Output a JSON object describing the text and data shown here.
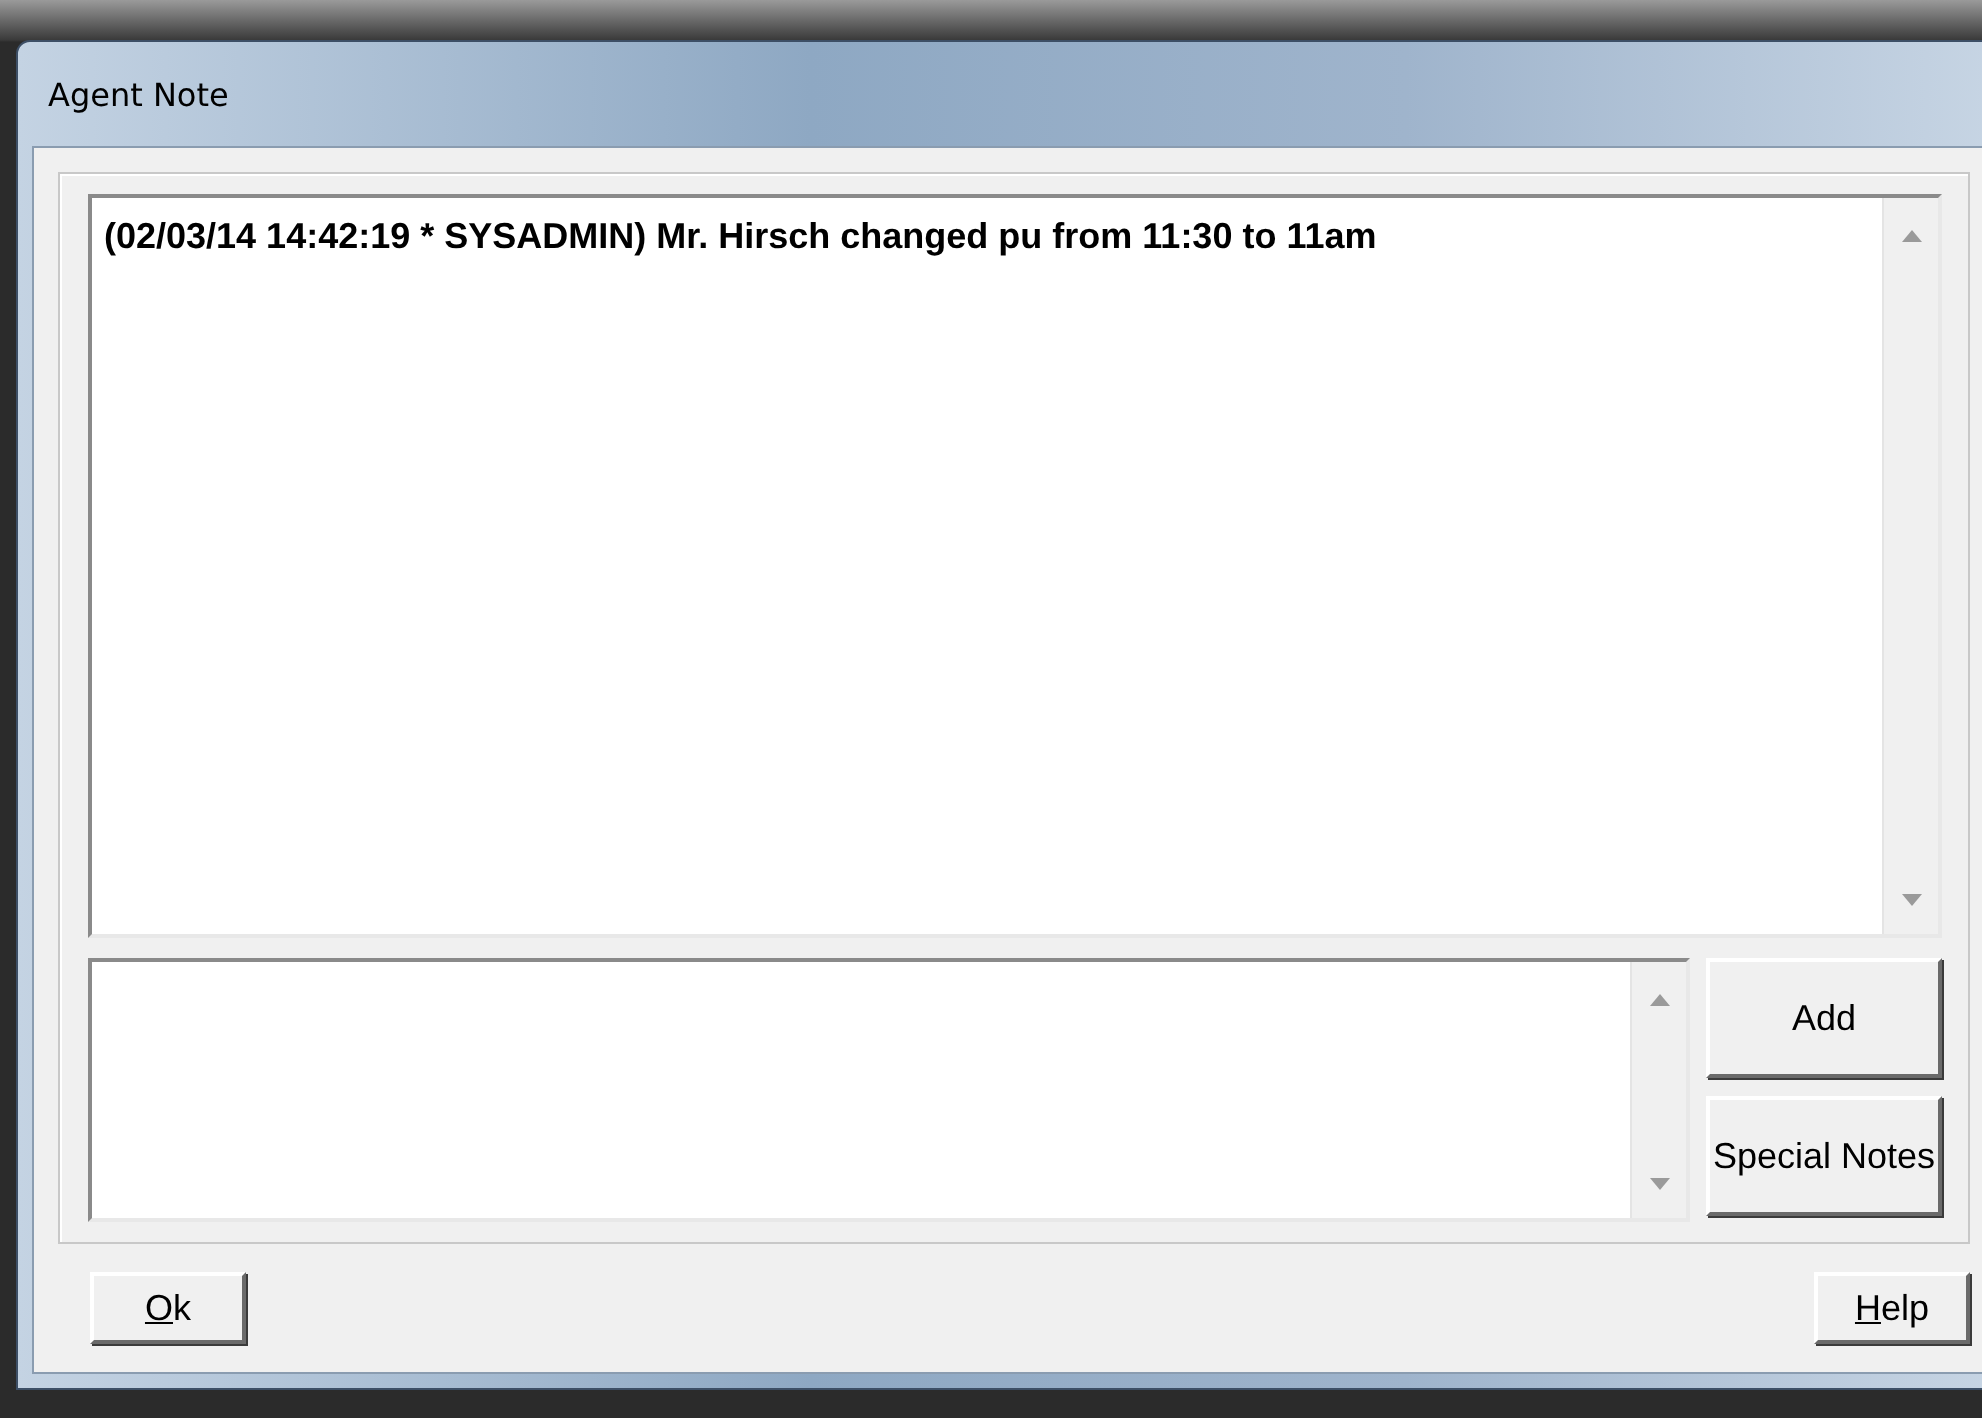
{
  "window": {
    "title": "Agent Note"
  },
  "log": {
    "text": "(02/03/14 14:42:19 * SYSADMIN) Mr. Hirsch changed pu from 11:30 to 11am"
  },
  "side_buttons": [
    {
      "label": "Add",
      "underline_first": false
    },
    {
      "label": "Special Notes",
      "underline_first": false
    }
  ],
  "footer_buttons": [
    {
      "label": "Ok",
      "underline_first": true
    },
    {
      "label": "Help",
      "underline_first": true
    }
  ]
}
